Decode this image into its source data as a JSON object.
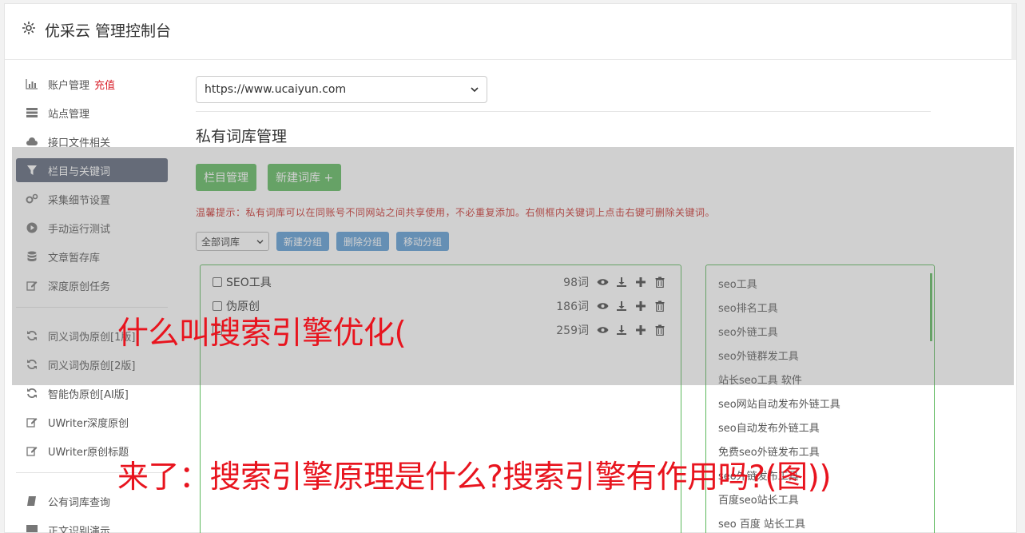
{
  "header": {
    "title": "优采云 管理控制台",
    "icon": "gear-icon"
  },
  "sidebar": {
    "items": [
      {
        "label": "账户管理",
        "badge": "充值",
        "icon": "bar-chart-icon"
      },
      {
        "label": "站点管理",
        "icon": "server-icon"
      },
      {
        "label": "接口文件相关",
        "icon": "cloud-upload-icon"
      },
      {
        "label": "栏目与关键词",
        "icon": "filter-icon",
        "active": true
      },
      {
        "label": "采集细节设置",
        "icon": "gears-icon"
      },
      {
        "label": "手动运行测试",
        "icon": "play-icon"
      },
      {
        "label": "文章暂存库",
        "icon": "database-icon"
      },
      {
        "label": "深度原创任务",
        "icon": "edit-icon"
      }
    ],
    "items2": [
      {
        "label": "同义词伪原创[1版]",
        "icon": "refresh-icon"
      },
      {
        "label": "同义词伪原创[2版]",
        "icon": "refresh-icon"
      },
      {
        "label": "智能伪原创[AI版]",
        "icon": "refresh-icon"
      },
      {
        "label": "UWriter深度原创",
        "icon": "edit-icon"
      },
      {
        "label": "UWriter原创标题",
        "icon": "edit-icon"
      }
    ],
    "items3": [
      {
        "label": "公有词库查询",
        "icon": "book-icon"
      },
      {
        "label": "正文识别演示",
        "icon": "monitor-icon"
      }
    ]
  },
  "main": {
    "url_select": "https://www.ucaiyun.com",
    "section_title": "私有词库管理",
    "btn_columns": "栏目管理",
    "btn_new_lib": "新建词库 +",
    "tip": "温馨提示：私有词库可以在同账号不同网站之间共享使用，不必重复添加。右侧框内关键词上点击右键可删除关键词。",
    "group_select": "全部词库",
    "btn_new_group": "新建分组",
    "btn_delete_group": "删除分组",
    "btn_move_group": "移动分组",
    "libraries": [
      {
        "name": "SEO工具",
        "count": "98词"
      },
      {
        "name": "伪原创",
        "count": "186词"
      },
      {
        "name": "",
        "count": "259词"
      }
    ],
    "keywords": [
      "seo工具",
      "seo排名工具",
      "seo外链工具",
      "seo外链群发工具",
      "站长seo工具 软件",
      "seo网站自动发布外链工具",
      "seo自动发布外链工具",
      "免费seo外链发布工具",
      "seo外链发布工具",
      "百度seo站长工具",
      "seo 百度 站长工具"
    ]
  },
  "captions": {
    "line1": "什么叫搜索引擎优化(",
    "line2": "来了：搜索引擎原理是什么?搜索引擎有作用吗?(图))"
  }
}
